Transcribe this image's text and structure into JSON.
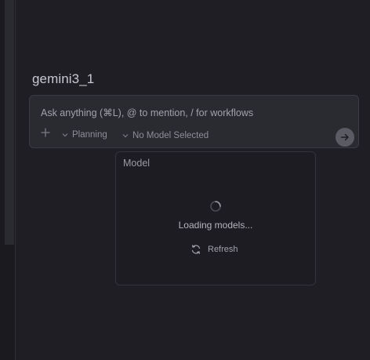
{
  "workspace": {
    "title": "gemini3_1"
  },
  "chat": {
    "placeholder": "Ask anything (⌘L), @ to mention, / for workflows",
    "mode_label": "Planning",
    "model_label": "No Model Selected"
  },
  "model_popup": {
    "title": "Model",
    "loading_text": "Loading models...",
    "refresh_label": "Refresh"
  },
  "icons": {
    "add": "plus-icon",
    "mode_dropdown": "chevron-down-icon",
    "model_dropdown": "chevron-down-icon",
    "send": "arrow-right-icon",
    "loading": "spinner-icon",
    "refresh": "refresh-icon"
  },
  "colors": {
    "background": "#1e1e24",
    "input_background": "#2a2a31",
    "send_button": "#5b5b64",
    "text_muted": "#8e8e98"
  }
}
